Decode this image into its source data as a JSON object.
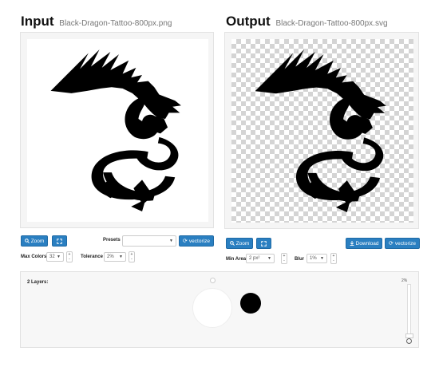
{
  "input": {
    "heading": "Input",
    "filename": "Black-Dragon-Tattoo-800px.png",
    "zoom_label": "Zoom",
    "presets_label": "Presets",
    "presets_value": "",
    "vectorize_label": "vectorize",
    "max_colors_label": "Max Colors",
    "max_colors_value": "32",
    "tolerance_label": "Tolerance",
    "tolerance_value": "2%"
  },
  "output": {
    "heading": "Output",
    "filename": "Black-Dragon-Tattoo-800px.svg",
    "zoom_label": "Zoom",
    "download_label": "Download",
    "vectorize_label": "vectorize",
    "min_area_label": "Min Area",
    "min_area_value": "2 px²",
    "blur_label": "Blur",
    "blur_value": "1%"
  },
  "layers": {
    "title": "2 Layers:",
    "slider_value": "2%",
    "swatches": [
      "#ffffff",
      "#000000"
    ]
  },
  "icons": {
    "zoom": "search-icon",
    "fullscreen": "expand-icon",
    "vectorize": "refresh-icon",
    "download": "download-icon",
    "reset": "circle-icon"
  }
}
